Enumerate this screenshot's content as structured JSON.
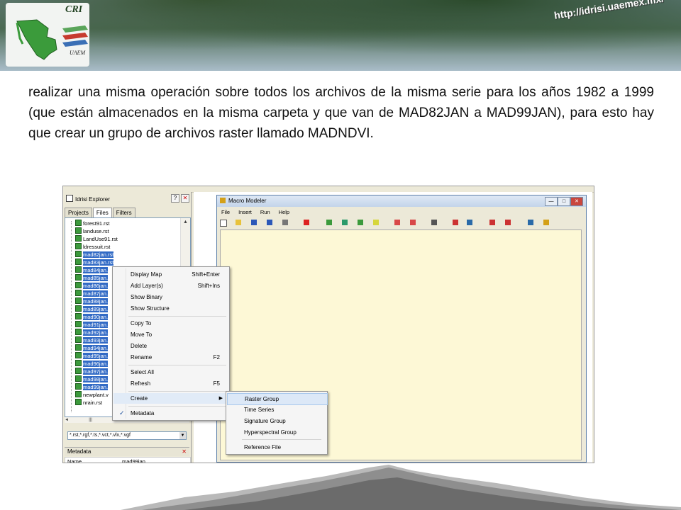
{
  "banner": {
    "url": "http://idrisi.uaemex.mx/",
    "logo_top": "CRI",
    "logo_bottom": "UAEM"
  },
  "paragraph": "realizar una misma operación sobre todos los archivos de la misma serie para los años 1982 a 1999 (que están almacenados en la misma carpeta y que van de MAD82JAN a MAD99JAN), para esto hay que crear un grupo de archivos raster llamado MADNDVI.",
  "explorer": {
    "title": "Idrisi Explorer",
    "tabs": [
      "Projects",
      "Files",
      "Filters"
    ],
    "files": [
      "forest91.rst",
      "landuse.rst",
      "LandUse91.rst",
      "ldressuit.rst",
      "mad82jan.rst",
      "mad83jan.rst",
      "mad84jan.",
      "mad85jan.",
      "mad86jan.",
      "mad87jan.",
      "mad88jan.",
      "mad89jan.",
      "mad90jan.",
      "mad91jan.",
      "mad92jan.",
      "mad93jan.",
      "mad94jan.",
      "mad95jan.",
      "mad96jan.",
      "mad97jan.",
      "mad98jan.",
      "mad99jan.",
      "newplant.v",
      "nrain.rst"
    ],
    "filter": "*.rst,*.rgf,*.ts,*.vct,*.vlx,*.vgf",
    "metadata_title": "Metadata",
    "meta_key": "Name",
    "meta_value": "mad99jan"
  },
  "macro_modeler": {
    "title": "Macro Modeler",
    "menu": [
      "File",
      "Insert",
      "Run",
      "Help"
    ]
  },
  "context_menu": {
    "items": [
      {
        "label": "Display Map",
        "shortcut": "Shift+Enter"
      },
      {
        "label": "Add Layer(s)",
        "shortcut": "Shift+Ins"
      },
      {
        "label": "Show Binary",
        "shortcut": ""
      },
      {
        "label": "Show Structure",
        "shortcut": ""
      },
      {
        "label": "Copy To",
        "shortcut": ""
      },
      {
        "label": "Move To",
        "shortcut": ""
      },
      {
        "label": "Delete",
        "shortcut": ""
      },
      {
        "label": "Rename",
        "shortcut": "F2"
      },
      {
        "label": "Select All",
        "shortcut": ""
      },
      {
        "label": "Refresh",
        "shortcut": "F5"
      },
      {
        "label": "Create",
        "shortcut": ""
      },
      {
        "label": "Metadata",
        "shortcut": ""
      }
    ]
  },
  "create_submenu": {
    "items": [
      "Raster Group",
      "Time Series",
      "Signature Group",
      "Hyperspectral Group",
      "Reference File"
    ]
  }
}
